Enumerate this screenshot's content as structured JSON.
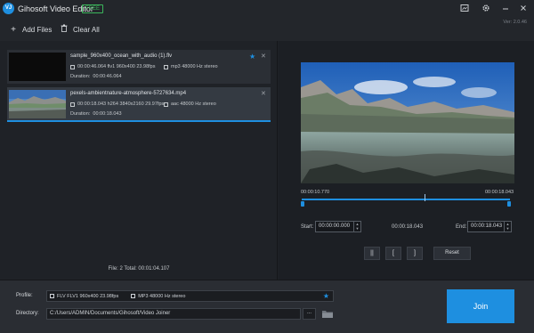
{
  "app": {
    "logo_text": "VJ",
    "title": "Gihosoft Video Editor",
    "badge": "FREE",
    "version": "Ver: 2.0.46",
    "accent_color": "#1e8fe0"
  },
  "toolbar": {
    "add_files_label": "Add Files",
    "clear_all_label": "Clear All"
  },
  "files": [
    {
      "name": "sample_960x400_ocean_with_audio (1).flv",
      "video_info": "00:00:46.064 flv1 960x400 23.98fps",
      "audio_info": "mp3 48000 Hz stereo",
      "duration_label": "Duration:",
      "duration": "00:00:46.064"
    },
    {
      "name": "pexels-ambientnature-atmosphere-5727634.mp4",
      "video_info": "00:00:18.043 h264 3840x2160 29.97fps",
      "audio_info": "aac 48000 Hz stereo",
      "duration_label": "Duration:",
      "duration": "00:00:18.043"
    }
  ],
  "summary": "File: 2  Total: 00:01:04.107",
  "player": {
    "current_time": "00:00:10.770",
    "end_time": "00:00:18.043",
    "start_label": "Start:",
    "start_value": "00:00:00.000",
    "middle_time": "00:00:18.043",
    "end_label": "End:",
    "end_value": "00:00:18.043",
    "pause_symbol": "||",
    "mark_in_symbol": "[",
    "mark_out_symbol": "]",
    "reset_label": "Reset"
  },
  "output": {
    "profile_label": "Profile:",
    "profile_video": "FLV FLV1 960x400 23.98fps",
    "profile_audio": "MP3 48000 Hz stereo",
    "directory_label": "Directory:",
    "directory_value": "C:/Users/ADMIN/Documents/Gihosoft/Video Joiner",
    "browse_label": "...",
    "join_label": "Join"
  }
}
